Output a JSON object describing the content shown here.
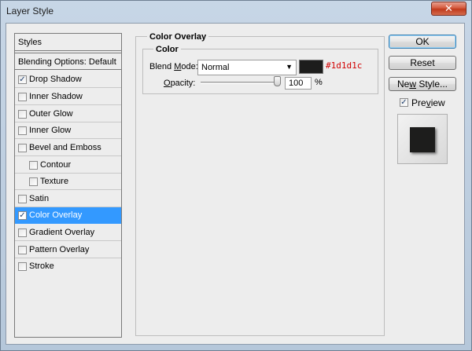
{
  "window": {
    "title": "Layer Style",
    "close_glyph": "✕"
  },
  "styles_panel": {
    "header": "Styles",
    "blending_options": "Blending Options: Default",
    "items": [
      {
        "label": "Drop Shadow",
        "checked": true,
        "check": "✓"
      },
      {
        "label": "Inner Shadow",
        "checked": false,
        "check": ""
      },
      {
        "label": "Outer Glow",
        "checked": false,
        "check": ""
      },
      {
        "label": "Inner Glow",
        "checked": false,
        "check": ""
      },
      {
        "label": "Bevel and Emboss",
        "checked": false,
        "check": ""
      },
      {
        "label": "Contour",
        "checked": false,
        "check": ""
      },
      {
        "label": "Texture",
        "checked": false,
        "check": ""
      },
      {
        "label": "Satin",
        "checked": false,
        "check": ""
      },
      {
        "label": "Color Overlay",
        "checked": true,
        "check": "✓",
        "selected": true
      },
      {
        "label": "Gradient Overlay",
        "checked": false,
        "check": ""
      },
      {
        "label": "Pattern Overlay",
        "checked": false,
        "check": ""
      },
      {
        "label": "Stroke",
        "checked": false,
        "check": ""
      }
    ]
  },
  "color_overlay": {
    "group_title": "Color Overlay",
    "sub_title": "Color",
    "blend_mode_label_pre": "Blend ",
    "blend_mode_label_mnemonic": "M",
    "blend_mode_label_post": "ode:",
    "blend_mode_value": "Normal",
    "dropdown_arrow": "▼",
    "color_hex": "#1d1d1c",
    "color_swatch": "#1d1d1c",
    "opacity_label_mnemonic": "O",
    "opacity_label_post": "pacity:",
    "opacity_value": "100",
    "opacity_unit": "%",
    "opacity_level": 1.0
  },
  "buttons": {
    "ok": "OK",
    "reset": "Reset",
    "new_style_pre": "Ne",
    "new_style_mnemonic": "w",
    "new_style_post": " Style..."
  },
  "preview": {
    "label_pre": "Pre",
    "label_mnemonic": "v",
    "label_post": "iew",
    "checked": true,
    "check": "✓"
  },
  "colors": {
    "selection": "#3399ff",
    "hex_annotation": "#d10000"
  }
}
